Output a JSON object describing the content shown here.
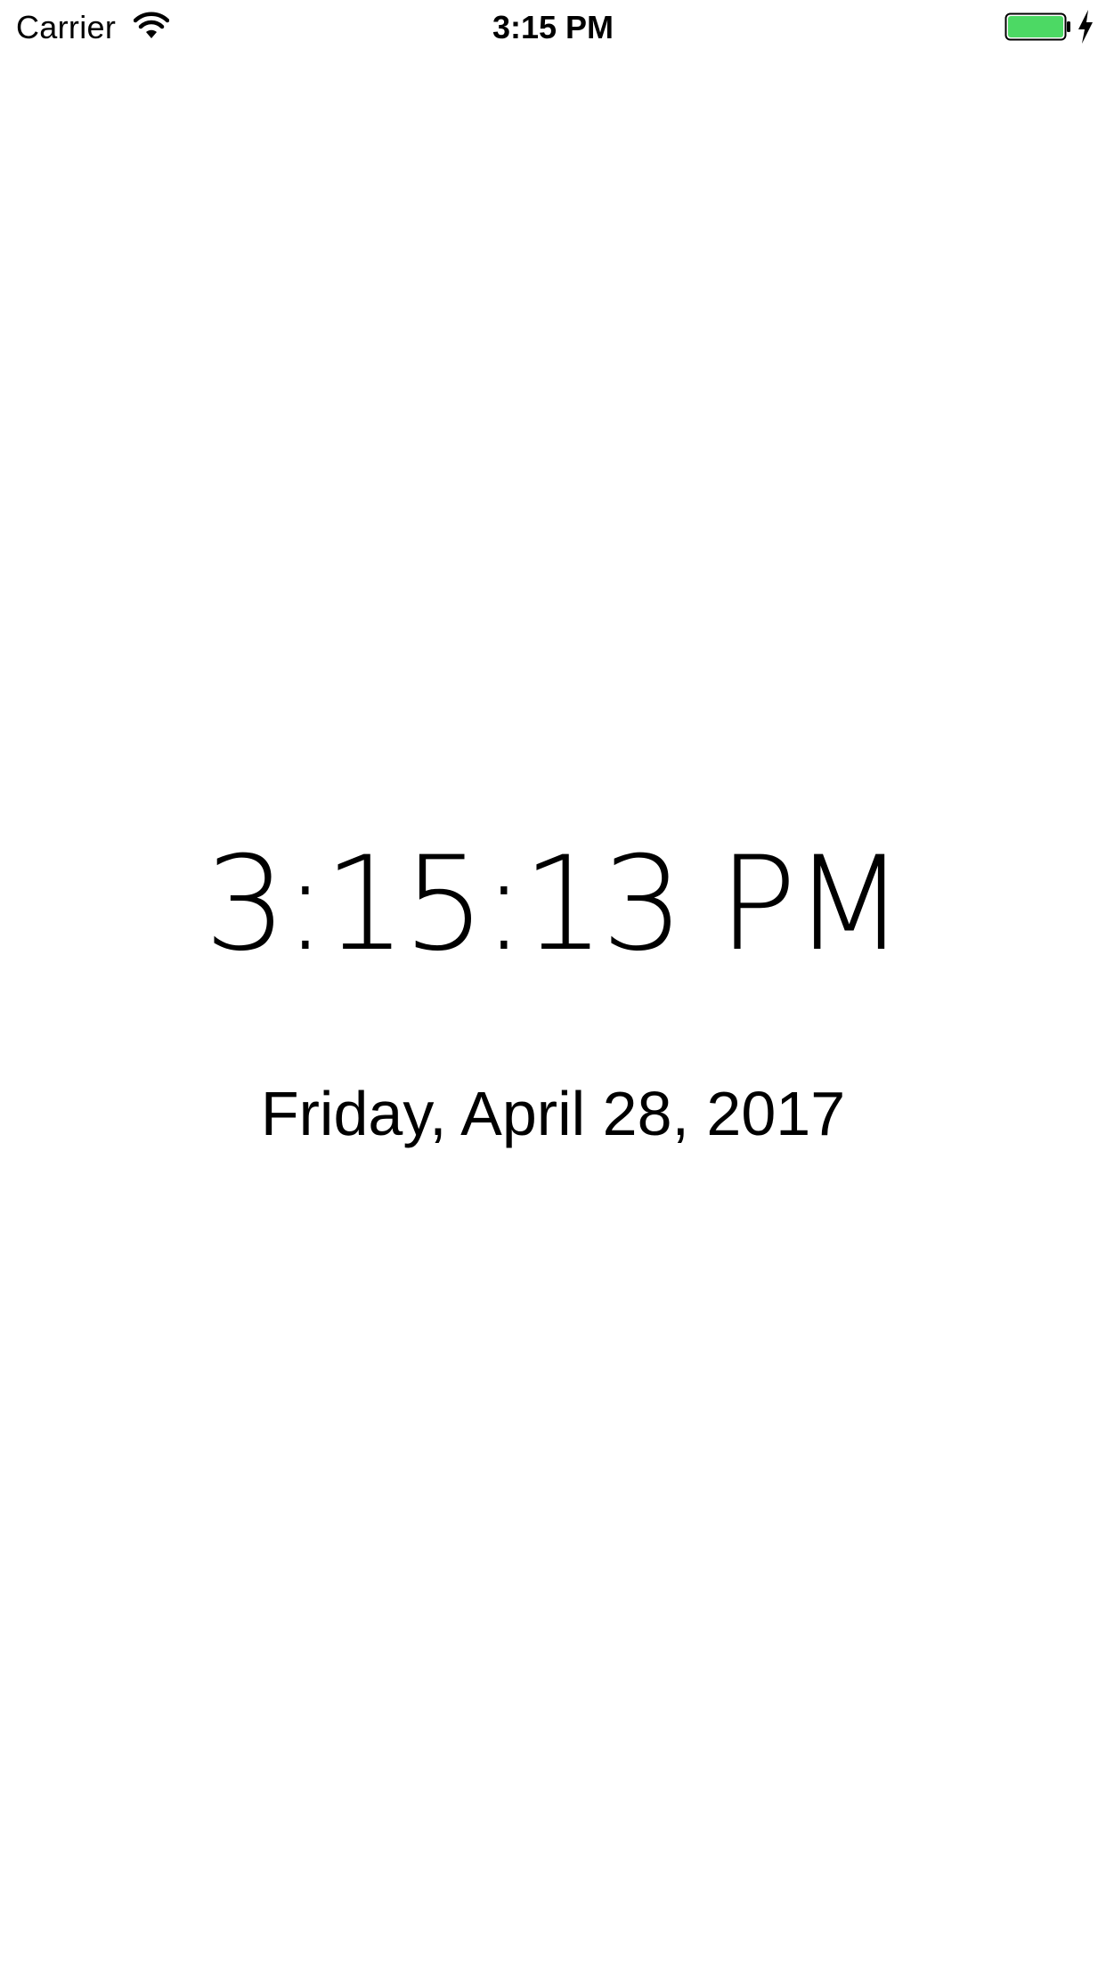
{
  "status_bar": {
    "carrier": "Carrier",
    "time": "3:15 PM",
    "wifi_icon": "wifi-icon",
    "battery_icon": "battery-icon",
    "charging_icon": "charging-bolt-icon",
    "battery_level": 1.0,
    "battery_color": "#4cd964"
  },
  "clock": {
    "time": "3:15:13 PM",
    "date": "Friday, April 28, 2017"
  }
}
